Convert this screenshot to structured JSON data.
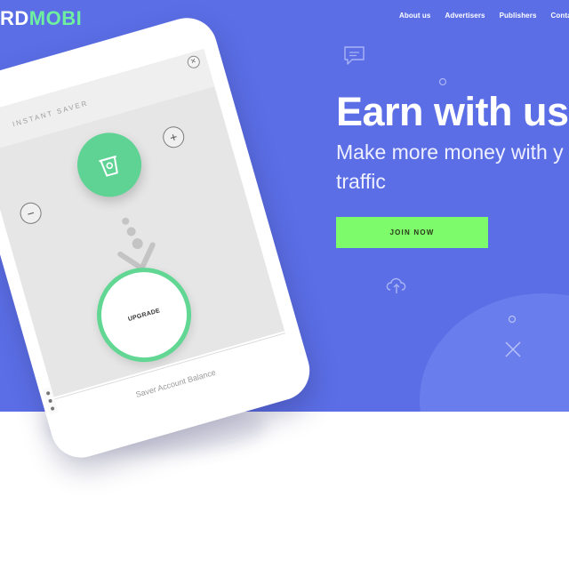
{
  "header": {
    "logo_part1": "RD",
    "logo_part2": "MOBI",
    "nav": [
      "About us",
      "Advertisers",
      "Publishers",
      "Contac"
    ]
  },
  "hero": {
    "headline": "Earn with us",
    "subline": "Make more money with y traffic",
    "cta_label": "JOIN NOW"
  },
  "phone": {
    "saver_title": "INSTANT SAVER",
    "close_symbol": "×",
    "minus_symbol": "−",
    "plus_symbol": "+",
    "upgrade_label": "UPGRADE",
    "balance_label": "Saver Account Balance"
  },
  "colors": {
    "hero_bg": "#5b6ee6",
    "cta_bg": "#7dfb6a",
    "accent_green": "#5fd394",
    "logo_accent": "#6ef0a0"
  },
  "icons": [
    "chat-bubble-icon",
    "cloud-upload-icon",
    "close-x-icon",
    "cup-icon",
    "arrow-down-icon"
  ]
}
